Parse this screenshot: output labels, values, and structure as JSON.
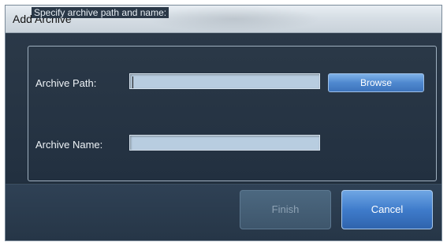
{
  "window": {
    "title": "Add Archive"
  },
  "group": {
    "legend": "Specify archive path and name:"
  },
  "archive_path": {
    "label": "Archive Path:",
    "value": ""
  },
  "archive_name": {
    "label": "Archive Name:",
    "value": ""
  },
  "buttons": {
    "browse": "Browse",
    "finish": "Finish",
    "cancel": "Cancel"
  },
  "button_states": {
    "finish_enabled": false
  },
  "colors": {
    "dialog_background": "#223040",
    "input_fill": "#b8cde0",
    "accent_button": "#4f88cf"
  }
}
